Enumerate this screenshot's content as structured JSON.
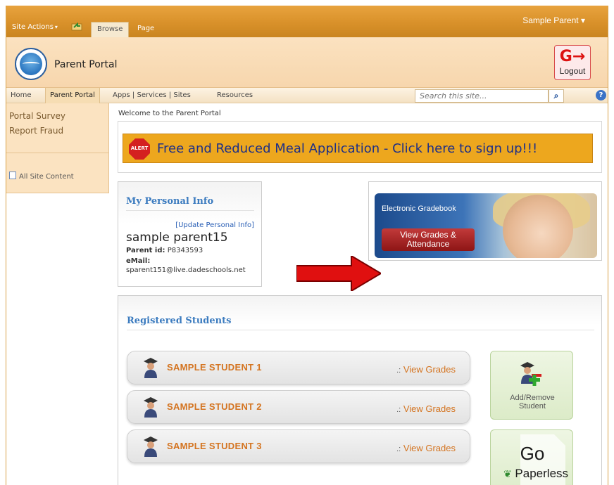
{
  "ribbon": {
    "site_actions": "Site Actions",
    "tabs": [
      "Browse",
      "Page"
    ],
    "user": "Sample Parent"
  },
  "header": {
    "site_title": "Parent Portal",
    "logout_label": "Logout"
  },
  "topnav": {
    "items": [
      "Home",
      "Parent Portal",
      "Apps | Services | Sites",
      "Resources"
    ],
    "selected": "Parent Portal",
    "search_placeholder": "Search this site..."
  },
  "leftnav": {
    "items": [
      "Portal Survey",
      "Report Fraud"
    ],
    "all_site_content": "All Site Content"
  },
  "main": {
    "welcome": "Welcome to the Parent Portal",
    "alert_badge": "ALERT",
    "meal_banner": "Free and Reduced Meal Application - Click here to sign up!!!",
    "personal_info": {
      "title": "My Personal Info",
      "update_link": "[Update Personal Info]",
      "name": "sample parent15",
      "parent_id_label": "Parent id:",
      "parent_id": "P8343593",
      "email_label": "eMail:",
      "email": "sparent151@live.dadeschools.net"
    },
    "gradebook": {
      "title": "Electronic Gradebook",
      "button_line1": "View Grades &",
      "button_line2": "Attendance"
    },
    "students": {
      "title": "Registered Students",
      "rows": [
        {
          "name": "SAMPLE STUDENT 1",
          "link_prefix": ".:",
          "link": "View Grades"
        },
        {
          "name": "SAMPLE STUDENT 2",
          "link_prefix": ".:",
          "link": "View Grades"
        },
        {
          "name": "SAMPLE STUDENT 3",
          "link_prefix": ".:",
          "link": "View Grades"
        }
      ],
      "add_remove_line1": "Add/Remove",
      "add_remove_line2": "Student",
      "go": "Go",
      "paperless": "Paperless"
    }
  },
  "colors": {
    "ribbon": "#d9912a",
    "header_bg": "#f7d6ad",
    "accent_blue": "#3b7bbf",
    "student_orange": "#d47420",
    "meal_banner": "#eda71e",
    "arrow_red": "#e01010"
  },
  "icons": [
    "navigate-up-icon",
    "logout-icon",
    "search-icon",
    "help-icon",
    "document-icon",
    "alert-icon",
    "graduate-icon",
    "add-student-icon",
    "leaf-icon",
    "red-arrow"
  ]
}
